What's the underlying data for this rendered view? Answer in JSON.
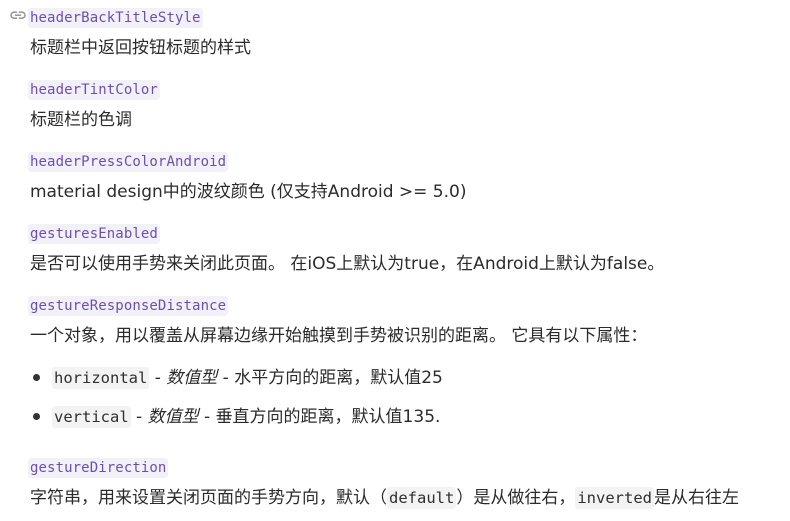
{
  "props": [
    {
      "name": "headerBackTitleStyle",
      "desc": "标题栏中返回按钮标题的样式"
    },
    {
      "name": "headerTintColor",
      "desc": "标题栏的色调"
    },
    {
      "name": "headerPressColorAndroid",
      "desc": "material design中的波纹颜色 (仅支持Android >= 5.0)"
    },
    {
      "name": "gesturesEnabled",
      "desc": "是否可以使用手势来关闭此页面。 在iOS上默认为true，在Android上默认为false。"
    },
    {
      "name": "gestureResponseDistance",
      "desc": "一个对象，用以覆盖从屏幕边缘开始触摸到手势被识别的距离。 它具有以下属性："
    }
  ],
  "distance_items": [
    {
      "code": "horizontal",
      "sep1": " - ",
      "type": "数值型",
      "sep2": " - ",
      "text": "水平方向的距离，默认值25"
    },
    {
      "code": "vertical",
      "sep1": " - ",
      "type": "数值型",
      "sep2": " - ",
      "text": "垂直方向的距离，默认值135."
    }
  ],
  "last": {
    "name": "gestureDirection",
    "t1": "字符串，用来设置关闭页面的手势方向，默认（",
    "c1": "default",
    "t2": "）是从做往右，",
    "c2": "inverted",
    "t3": "是从右往左"
  },
  "icons": {
    "anchor": "link-icon"
  }
}
